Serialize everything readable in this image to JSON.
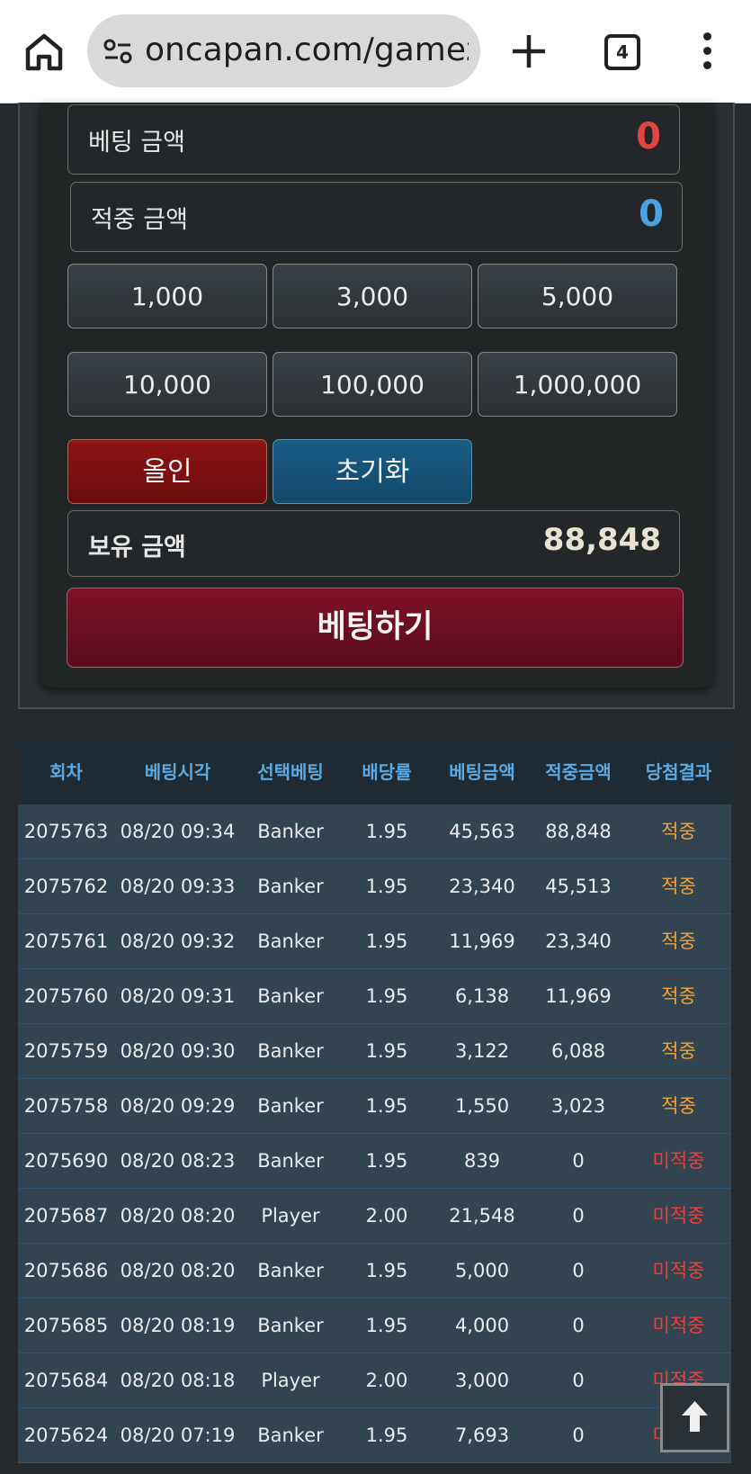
{
  "browser": {
    "url": "oncapan.com/gamezc",
    "tab_count": "4",
    "icons": [
      "home-icon",
      "site-settings-icon",
      "plus-icon",
      "tabs-icon",
      "more-vert-icon"
    ]
  },
  "bet_panel": {
    "bet_amount_label": "베팅 금액",
    "bet_amount_value": "0",
    "win_amount_label": "적중 금액",
    "win_amount_value": "0",
    "chips": [
      "1,000",
      "3,000",
      "5,000",
      "10,000",
      "100,000",
      "1,000,000"
    ],
    "allin_label": "올인",
    "reset_label": "초기화",
    "balance_label": "보유 금액",
    "balance_value": "88,848",
    "submit_label": "베팅하기",
    "colors": {
      "bet_value": "#e0453f",
      "win_value": "#4aa3e0",
      "balance_value": "#e8e2d2"
    }
  },
  "history": {
    "headers": [
      "회차",
      "베팅시각",
      "선택베팅",
      "배당률",
      "베팅금액",
      "적중금액",
      "당첨결과"
    ],
    "rows": [
      [
        "2075763",
        "08/20 09:34",
        "Banker",
        "1.95",
        "45,563",
        "88,848",
        "적중"
      ],
      [
        "2075762",
        "08/20 09:33",
        "Banker",
        "1.95",
        "23,340",
        "45,513",
        "적중"
      ],
      [
        "2075761",
        "08/20 09:32",
        "Banker",
        "1.95",
        "11,969",
        "23,340",
        "적중"
      ],
      [
        "2075760",
        "08/20 09:31",
        "Banker",
        "1.95",
        "6,138",
        "11,969",
        "적중"
      ],
      [
        "2075759",
        "08/20 09:30",
        "Banker",
        "1.95",
        "3,122",
        "6,088",
        "적중"
      ],
      [
        "2075758",
        "08/20 09:29",
        "Banker",
        "1.95",
        "1,550",
        "3,023",
        "적중"
      ],
      [
        "2075690",
        "08/20 08:23",
        "Banker",
        "1.95",
        "839",
        "0",
        "미적중"
      ],
      [
        "2075687",
        "08/20 08:20",
        "Player",
        "2.00",
        "21,548",
        "0",
        "미적중"
      ],
      [
        "2075686",
        "08/20 08:20",
        "Banker",
        "1.95",
        "5,000",
        "0",
        "미적중"
      ],
      [
        "2075685",
        "08/20 08:19",
        "Banker",
        "1.95",
        "4,000",
        "0",
        "미적중"
      ],
      [
        "2075684",
        "08/20 08:18",
        "Player",
        "2.00",
        "3,000",
        "0",
        "미적중"
      ],
      [
        "2075624",
        "08/20 07:19",
        "Banker",
        "1.95",
        "7,693",
        "0",
        "미적중"
      ]
    ],
    "colors": {
      "win": "#f2a23a",
      "lose": "#e8413f",
      "header_text": "#5aa9e3"
    }
  },
  "scroll_top_icon": "arrow-up-icon"
}
